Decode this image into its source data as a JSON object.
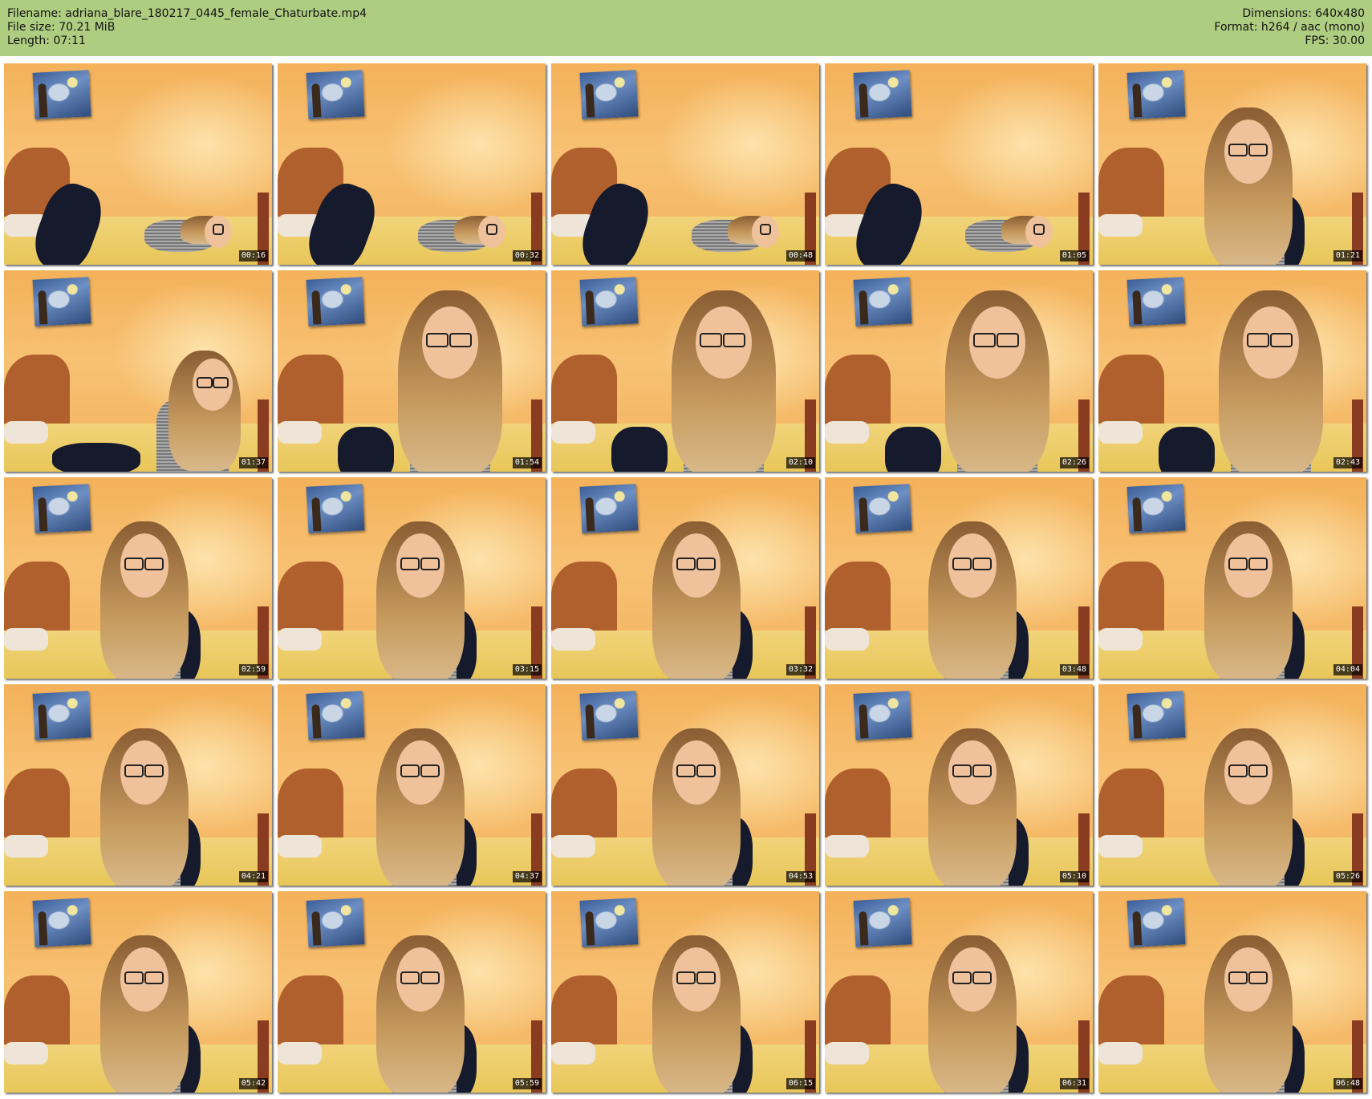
{
  "header": {
    "filename": "Filename: adriana_blare_180217_0445_female_Chaturbate.mp4",
    "filesize": "File size: 70.21 MiB",
    "length": "Length: 07:11",
    "dimensions": "Dimensions: 640x480",
    "format": "Format: h264 / aac (mono)",
    "fps": "FPS: 30.00"
  },
  "colors": {
    "header_bg": "#aecd81",
    "timestamp_bg": "#000000",
    "timestamp_text": "#ffffff"
  },
  "thumbnails": [
    {
      "time": "00:16",
      "pose": "lying"
    },
    {
      "time": "00:32",
      "pose": "lying"
    },
    {
      "time": "00:48",
      "pose": "lying"
    },
    {
      "time": "01:05",
      "pose": "lying"
    },
    {
      "time": "01:21",
      "pose": "sitting"
    },
    {
      "time": "01:37",
      "pose": "reclining"
    },
    {
      "time": "01:54",
      "pose": "close"
    },
    {
      "time": "02:10",
      "pose": "close"
    },
    {
      "time": "02:26",
      "pose": "close"
    },
    {
      "time": "02:43",
      "pose": "close"
    },
    {
      "time": "02:59",
      "pose": "sitting"
    },
    {
      "time": "03:15",
      "pose": "sitting"
    },
    {
      "time": "03:32",
      "pose": "sitting"
    },
    {
      "time": "03:48",
      "pose": "sitting"
    },
    {
      "time": "04:04",
      "pose": "sitting"
    },
    {
      "time": "04:21",
      "pose": "sitting"
    },
    {
      "time": "04:37",
      "pose": "sitting"
    },
    {
      "time": "04:53",
      "pose": "sitting"
    },
    {
      "time": "05:10",
      "pose": "sitting"
    },
    {
      "time": "05:26",
      "pose": "sitting"
    },
    {
      "time": "05:42",
      "pose": "sitting"
    },
    {
      "time": "05:59",
      "pose": "sitting"
    },
    {
      "time": "06:15",
      "pose": "sitting"
    },
    {
      "time": "06:31",
      "pose": "sitting"
    },
    {
      "time": "06:48",
      "pose": "sitting"
    }
  ]
}
